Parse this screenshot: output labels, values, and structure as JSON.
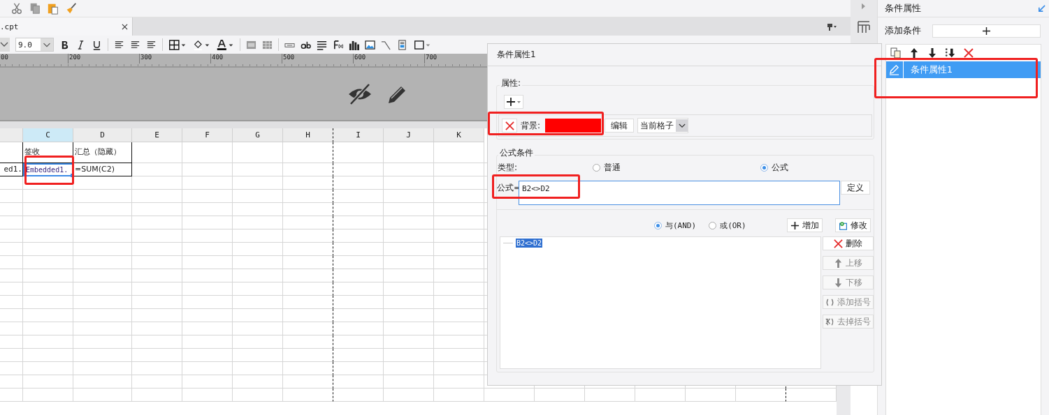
{
  "toolbar": {
    "font_size": "9.0"
  },
  "document_tab": {
    "label": ".cpt"
  },
  "ruler": {
    "labels": [
      "00",
      "200",
      "300",
      "400",
      "500",
      "600",
      "700"
    ]
  },
  "sheet": {
    "columns": [
      {
        "label": "C",
        "selected": true
      },
      {
        "label": "D",
        "selected": false
      },
      {
        "label": "E",
        "selected": false
      },
      {
        "label": "F",
        "selected": false
      },
      {
        "label": "G",
        "selected": false
      },
      {
        "label": "H",
        "selected": false
      },
      {
        "label": "I",
        "selected": false
      },
      {
        "label": "J",
        "selected": false
      },
      {
        "label": "K",
        "selected": false
      }
    ],
    "rows": [
      {
        "cells": [
          {
            "text": "签收",
            "selected": false
          },
          {
            "text": "汇总（隐藏）",
            "selected": false
          }
        ]
      },
      {
        "cut_cell": "ed1.",
        "cells": [
          {
            "text": "Embedded1.",
            "selected": true
          },
          {
            "text": "=SUM(C2)",
            "selected": false
          }
        ]
      }
    ]
  },
  "dialog": {
    "title": "条件属性1",
    "attributes": {
      "legend": "属性:",
      "items": [
        {
          "label": "背景:",
          "color": "#ff0000",
          "edit_button": "编辑",
          "scope": "当前格子"
        }
      ]
    },
    "formula_condition": {
      "legend": "公式条件",
      "type_label": "类型:",
      "types": [
        {
          "label": "普通",
          "selected": false
        },
        {
          "label": "公式",
          "selected": true
        }
      ],
      "formula_label": "公式=",
      "formula": "B2<>D2",
      "define_button": "定义",
      "logic": [
        {
          "label": "与(AND)",
          "selected": true
        },
        {
          "label": "或(OR)",
          "selected": false
        }
      ],
      "add_button": "增加",
      "modify_button": "修改",
      "conditions": [
        {
          "text": "B2<>D2",
          "selected": true
        }
      ],
      "actions": [
        {
          "label": "删除",
          "kind": "delete",
          "disabled": false
        },
        {
          "label": "上移",
          "kind": "up",
          "disabled": true
        },
        {
          "label": "下移",
          "kind": "down",
          "disabled": true
        },
        {
          "label": "添加括号",
          "kind": "add-brackets",
          "disabled": true
        },
        {
          "label": "去掉括号",
          "kind": "remove-brackets",
          "disabled": true
        }
      ]
    }
  },
  "right_panel": {
    "title": "条件属性",
    "add_label": "添加条件",
    "conditions": [
      {
        "label": "条件属性1",
        "selected": true
      }
    ]
  }
}
